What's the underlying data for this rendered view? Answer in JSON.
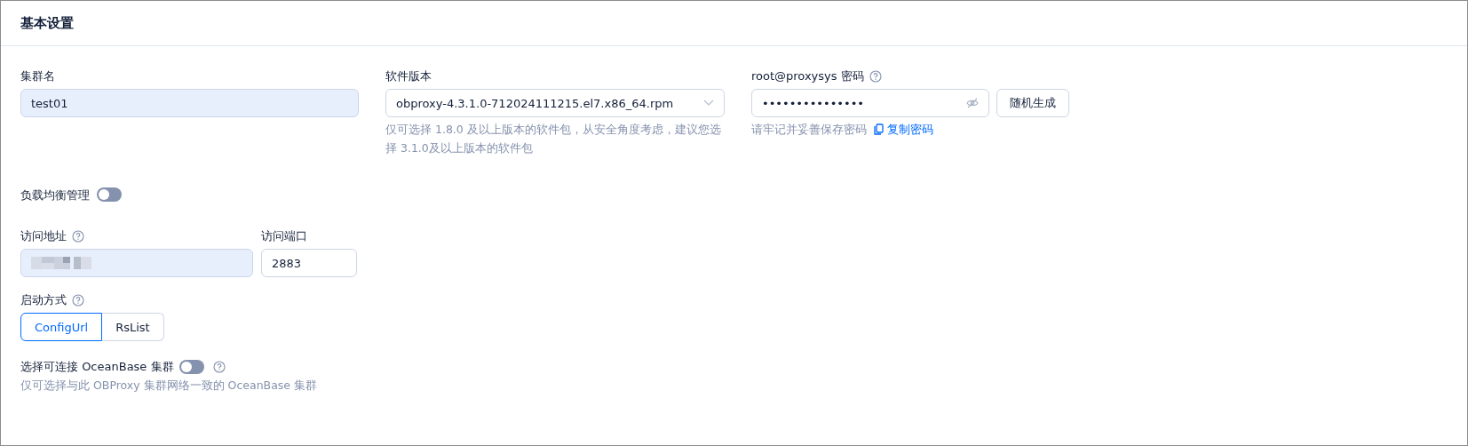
{
  "card": {
    "title": "基本设置"
  },
  "cluster_name": {
    "label": "集群名",
    "value": "test01"
  },
  "software_version": {
    "label": "软件版本",
    "value": "obproxy-4.3.1.0-712024111215.el7.x86_64.rpm",
    "hint": "仅可选择 1.8.0 及以上版本的软件包，从安全角度考虑，建议您选择 3.1.0及以上版本的软件包"
  },
  "password": {
    "label": "root@proxysys 密码",
    "value": "•••••••••••••••",
    "generate_button": "随机生成",
    "hint": "请牢记并妥善保存密码",
    "copy_link": "复制密码"
  },
  "load_balancing": {
    "label": "负载均衡管理",
    "on": false
  },
  "address": {
    "label": "访问地址"
  },
  "port": {
    "label": "访问端口",
    "value": "2883"
  },
  "startup_mode": {
    "label": "启动方式",
    "options": [
      {
        "label": "ConfigUrl",
        "selected": true
      },
      {
        "label": "RsList",
        "selected": false
      }
    ]
  },
  "connect_cluster": {
    "label": "选择可连接 OceanBase 集群",
    "on": false,
    "hint": "仅可选择与此 OBProxy 集群网络一致的 OceanBase 集群"
  }
}
